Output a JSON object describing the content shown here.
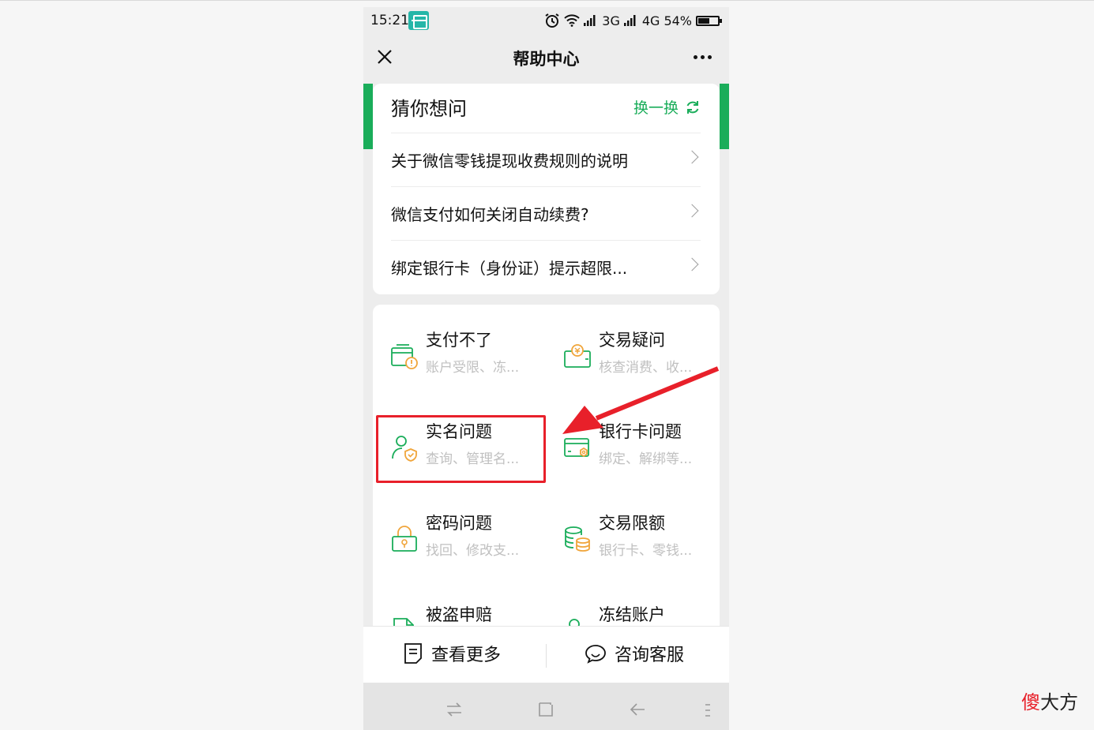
{
  "status_bar": {
    "time": "15:21",
    "network1": "3G",
    "network2": "4G",
    "battery": "54%"
  },
  "nav": {
    "title": "帮助中心"
  },
  "guess": {
    "title": "猜你想问",
    "refresh_label": "换一换",
    "questions": [
      "关于微信零钱提现收费规则的说明",
      "微信支付如何关闭自动续费?",
      "绑定银行卡（身份证）提示超限..."
    ]
  },
  "categories": [
    {
      "title": "支付不了",
      "sub": "账户受限、冻...",
      "icon": "wallet-warning-icon"
    },
    {
      "title": "交易疑问",
      "sub": "核查消费、收...",
      "icon": "yuan-wallet-icon"
    },
    {
      "title": "实名问题",
      "sub": "查询、管理名...",
      "icon": "user-shield-icon"
    },
    {
      "title": "银行卡问题",
      "sub": "绑定、解绑等...",
      "icon": "card-gear-icon"
    },
    {
      "title": "密码问题",
      "sub": "找回、修改支...",
      "icon": "lock-icon"
    },
    {
      "title": "交易限额",
      "sub": "银行卡、零钱...",
      "icon": "coins-stack-icon"
    },
    {
      "title": "被盗申赔",
      "sub": "",
      "icon": "document-icon"
    },
    {
      "title": "冻结账户",
      "sub": "",
      "icon": "user-lock-icon"
    }
  ],
  "bottom": {
    "more_label": "查看更多",
    "service_label": "咨询客服"
  },
  "watermark": {
    "part1": "傻",
    "part2": "大方"
  },
  "colors": {
    "accent": "#1aad5a",
    "annotation": "#e8202a",
    "icon_orange": "#f0a53b"
  }
}
